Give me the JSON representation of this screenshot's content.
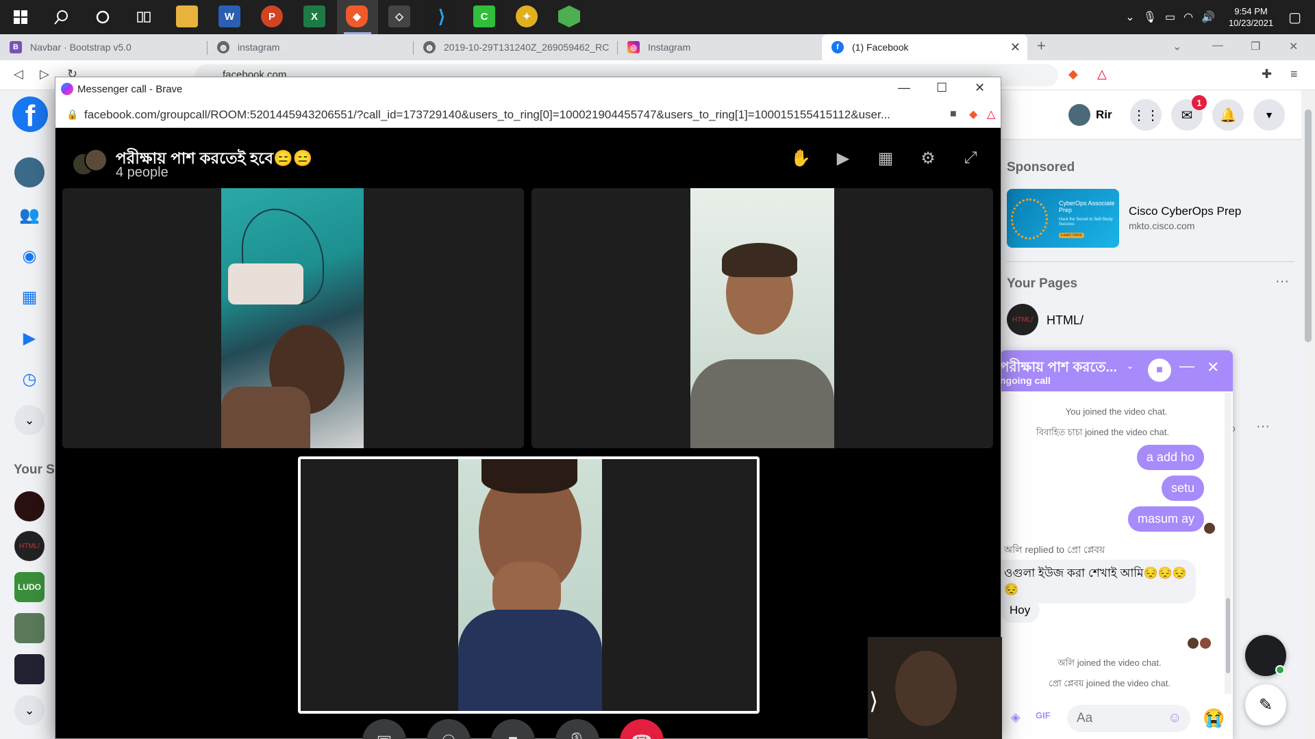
{
  "taskbar": {
    "clock_time": "9:54 PM",
    "clock_date": "10/23/2021"
  },
  "tabs": [
    {
      "label": "Navbar · Bootstrap v5.0",
      "icon": "bootstrap-icon"
    },
    {
      "label": "instagram",
      "icon": "globe-icon"
    },
    {
      "label": "2019-10-29T131240Z_269059462_RC",
      "icon": "globe-icon"
    },
    {
      "label": "Instagram",
      "icon": "instagram-icon"
    },
    {
      "label": "(1) Facebook",
      "icon": "facebook-icon"
    }
  ],
  "browser": {
    "url": "facebook.com"
  },
  "call_window": {
    "title": "Messenger call - Brave",
    "url": "facebook.com/groupcall/ROOM:5201445943206551/?call_id=173729140&users_to_ring[0]=100021904455747&users_to_ring[1]=100015155415112&user...",
    "group_name": "পরীক্ষায় পাশ করতেই হবে😑😑",
    "participant_count": "4 people"
  },
  "facebook": {
    "profile_name": "Rir",
    "notification_count": "1",
    "sponsored_heading": "Sponsored",
    "ad_title": "Cisco CyberOps Prep",
    "ad_domain": "mkto.cisco.com",
    "ad_image_line1": "CyberOps Associate Prep",
    "ad_image_line2": "Hack the Secret to Self-Study Success",
    "ad_image_button": "Learn more",
    "your_pages_heading": "Your Pages",
    "page_name": "HTML/",
    "page_avatar_text": "HTML/",
    "shortcuts_heading": "Your Sh"
  },
  "chat": {
    "title": "পরীক্ষায় পাশ করতে...",
    "subtitle": "ngoing call",
    "messages": {
      "sys1": "You joined the video chat.",
      "sys2": "বিবাহিত চাচা joined the video chat.",
      "me1": "a add ho",
      "me2": "setu",
      "me3": "masum ay",
      "reply_meta": "অলি replied to প্রো প্লেবয়",
      "quoted": "ওগুলা ইউজ করা শেখাই আমি😔😔😔😔",
      "them1": "Hoy",
      "sys3": "অলি joined the video chat.",
      "sys4": "প্রো প্লেবয় joined the video chat."
    },
    "input_placeholder": "Aa"
  },
  "colors": {
    "facebook_blue": "#1877f2",
    "chat_accent": "#a78bfa",
    "end_call": "#e41e3f"
  }
}
